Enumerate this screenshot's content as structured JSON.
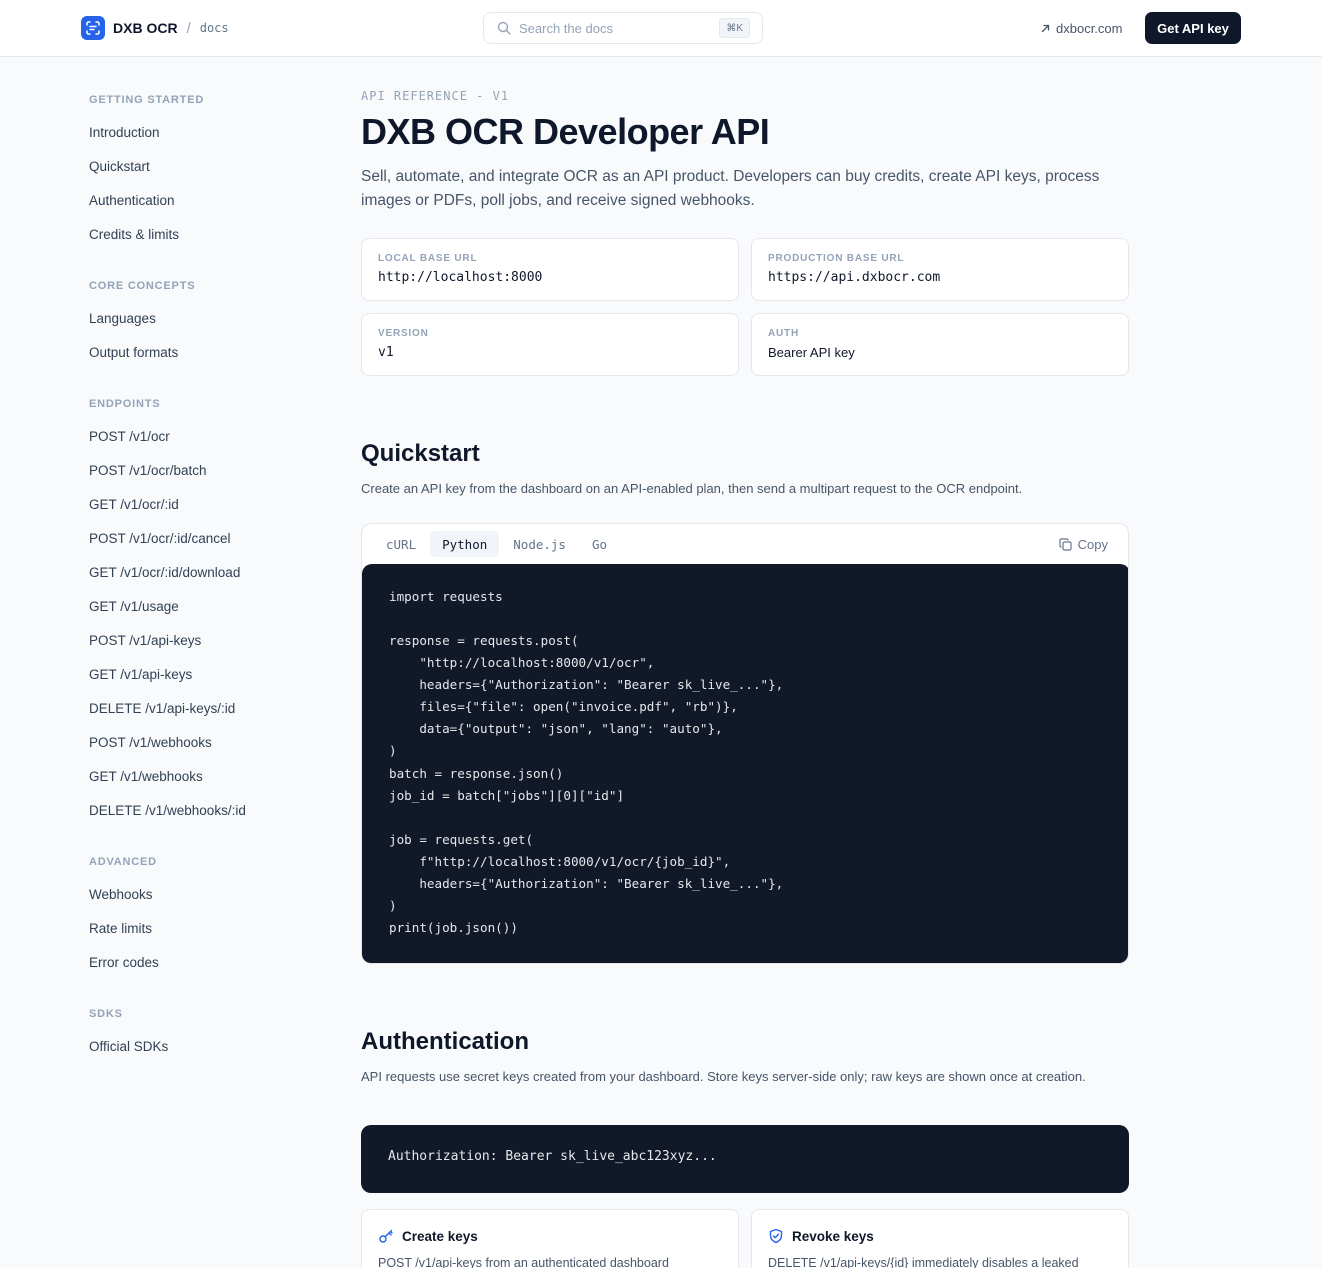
{
  "header": {
    "brand_name": "DXB OCR",
    "brand_separator": "/",
    "brand_section": "docs",
    "search_placeholder": "Search the docs",
    "search_shortcut": "⌘K",
    "external_link": "dxbocr.com",
    "cta_label": "Get API key"
  },
  "sidebar": {
    "groups": [
      {
        "title": "GETTING STARTED",
        "items": [
          "Introduction",
          "Quickstart",
          "Authentication",
          "Credits & limits"
        ]
      },
      {
        "title": "CORE CONCEPTS",
        "items": [
          "Languages",
          "Output formats"
        ]
      },
      {
        "title": "ENDPOINTS",
        "items": [
          "POST /v1/ocr",
          "POST /v1/ocr/batch",
          "GET /v1/ocr/:id",
          "POST /v1/ocr/:id/cancel",
          "GET /v1/ocr/:id/download",
          "GET /v1/usage",
          "POST /v1/api-keys",
          "GET /v1/api-keys",
          "DELETE /v1/api-keys/:id",
          "POST /v1/webhooks",
          "GET /v1/webhooks",
          "DELETE /v1/webhooks/:id"
        ]
      },
      {
        "title": "ADVANCED",
        "items": [
          "Webhooks",
          "Rate limits",
          "Error codes"
        ]
      },
      {
        "title": "SDKS",
        "items": [
          "Official SDKs"
        ]
      }
    ]
  },
  "intro": {
    "eyebrow": "API REFERENCE - V1",
    "title": "DXB OCR Developer API",
    "lead": "Sell, automate, and integrate OCR as an API product. Developers can buy credits, create API keys, process images or PDFs, poll jobs, and receive signed webhooks."
  },
  "info_cards": [
    {
      "label": "LOCAL BASE URL",
      "value": "http://localhost:8000"
    },
    {
      "label": "PRODUCTION BASE URL",
      "value": "https://api.dxbocr.com"
    },
    {
      "label": "VERSION",
      "value": "v1"
    },
    {
      "label": "AUTH",
      "value": "Bearer API key"
    }
  ],
  "quickstart": {
    "title": "Quickstart",
    "description": "Create an API key from the dashboard on an API-enabled plan, then send a multipart request to the OCR endpoint.",
    "tabs": [
      "cURL",
      "Python",
      "Node.js",
      "Go"
    ],
    "active_tab": "Python",
    "copy_label": "Copy",
    "code_lines": [
      "import requests",
      "",
      "response = requests.post(",
      "    \"http://localhost:8000/v1/ocr\",",
      "    headers={\"Authorization\": \"Bearer sk_live_...\"},",
      "    files={\"file\": open(\"invoice.pdf\", \"rb\")},",
      "    data={\"output\": \"json\", \"lang\": \"auto\"},",
      ")",
      "batch = response.json()",
      "job_id = batch[\"jobs\"][0][\"id\"]",
      "",
      "job = requests.get(",
      "    f\"http://localhost:8000/v1/ocr/{job_id}\",",
      "    headers={\"Authorization\": \"Bearer sk_live_...\"},",
      ")",
      "print(job.json())"
    ]
  },
  "authentication": {
    "title": "Authentication",
    "description": "API requests use secret keys created from your dashboard. Store keys server-side only; raw keys are shown once at creation.",
    "header_example": "Authorization: Bearer sk_live_abc123xyz...",
    "cards": [
      {
        "icon": "key-icon",
        "title": "Create keys",
        "description": "POST /v1/api-keys from an authenticated dashboard"
      },
      {
        "icon": "shield-icon",
        "title": "Revoke keys",
        "description": "DELETE /v1/api-keys/{id} immediately disables a leaked"
      }
    ]
  },
  "colors": {
    "accent": "#2563eb",
    "dark": "#0f172a",
    "code_bg": "#111827"
  }
}
